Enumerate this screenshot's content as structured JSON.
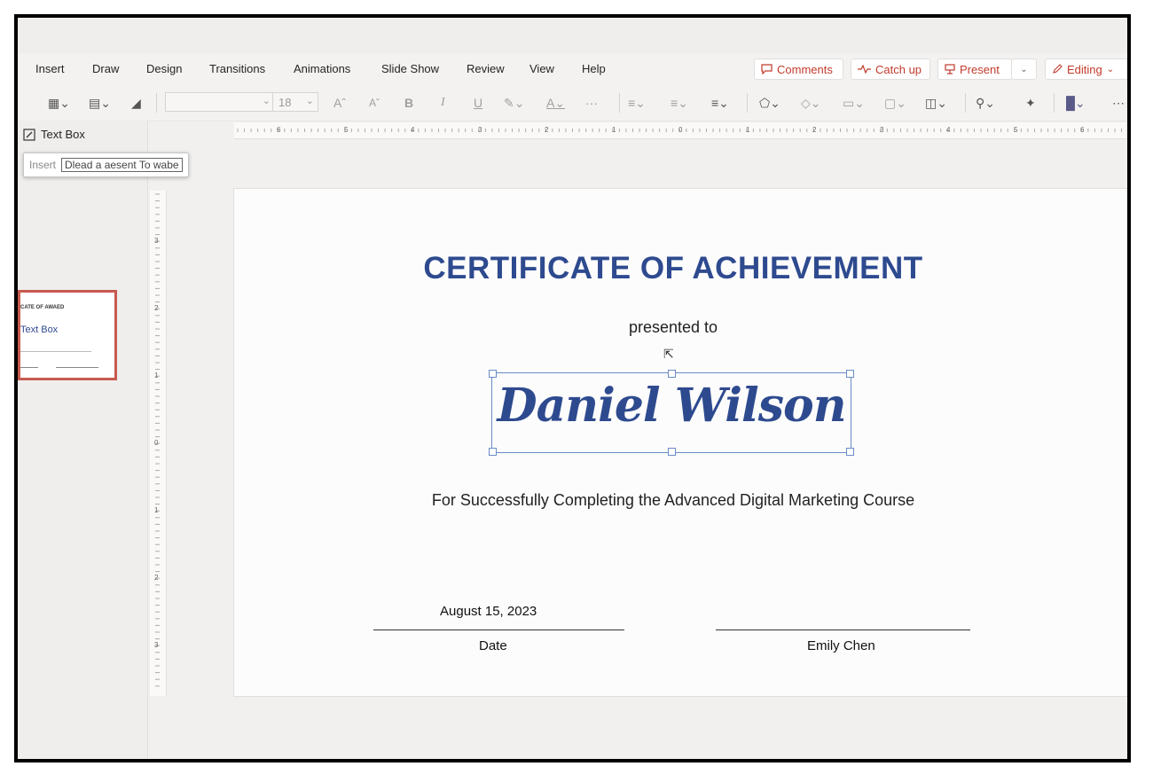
{
  "menu": {
    "items": [
      "Insert",
      "Draw",
      "Design",
      "Transitions",
      "Animations",
      "Slide Show",
      "Review",
      "View",
      "Help"
    ]
  },
  "ribbon_right": {
    "comments": "Comments",
    "catch_up": "Catch up",
    "present": "Present",
    "editing": "Editing"
  },
  "toolbar": {
    "font_size": "18",
    "bold": "B",
    "italic": "I",
    "underline": "U",
    "more": "···"
  },
  "rulers": {
    "horizontal": [
      "6",
      "5",
      "4",
      "3",
      "2",
      "1",
      "0",
      "1",
      "2",
      "3",
      "4",
      "5",
      "6"
    ],
    "vertical": [
      "3",
      "2",
      "1",
      "0",
      "1",
      "2",
      "3"
    ]
  },
  "left_pane": {
    "textbox_label": "Text Box",
    "tooltip_insert": "Insert",
    "tooltip_text": "Dlead a aesent To wabe",
    "thumb_title": "CATE OF AWAED",
    "thumb_name": "Text Box"
  },
  "slide": {
    "title": "CERTIFICATE OF ACHIEVEMENT",
    "presented_to": "presented to",
    "recipient": "Daniel Wilson",
    "completion_text": "For Successfully Completing the  Advanced Digital Marketing Course",
    "date_value": "August 15, 2023",
    "date_label": "Date",
    "signer": "Emily Chen"
  },
  "colors": {
    "accent": "#2e4a8f",
    "ribbon_text": "#c23a2b",
    "thumb_border": "#c85a4f"
  }
}
